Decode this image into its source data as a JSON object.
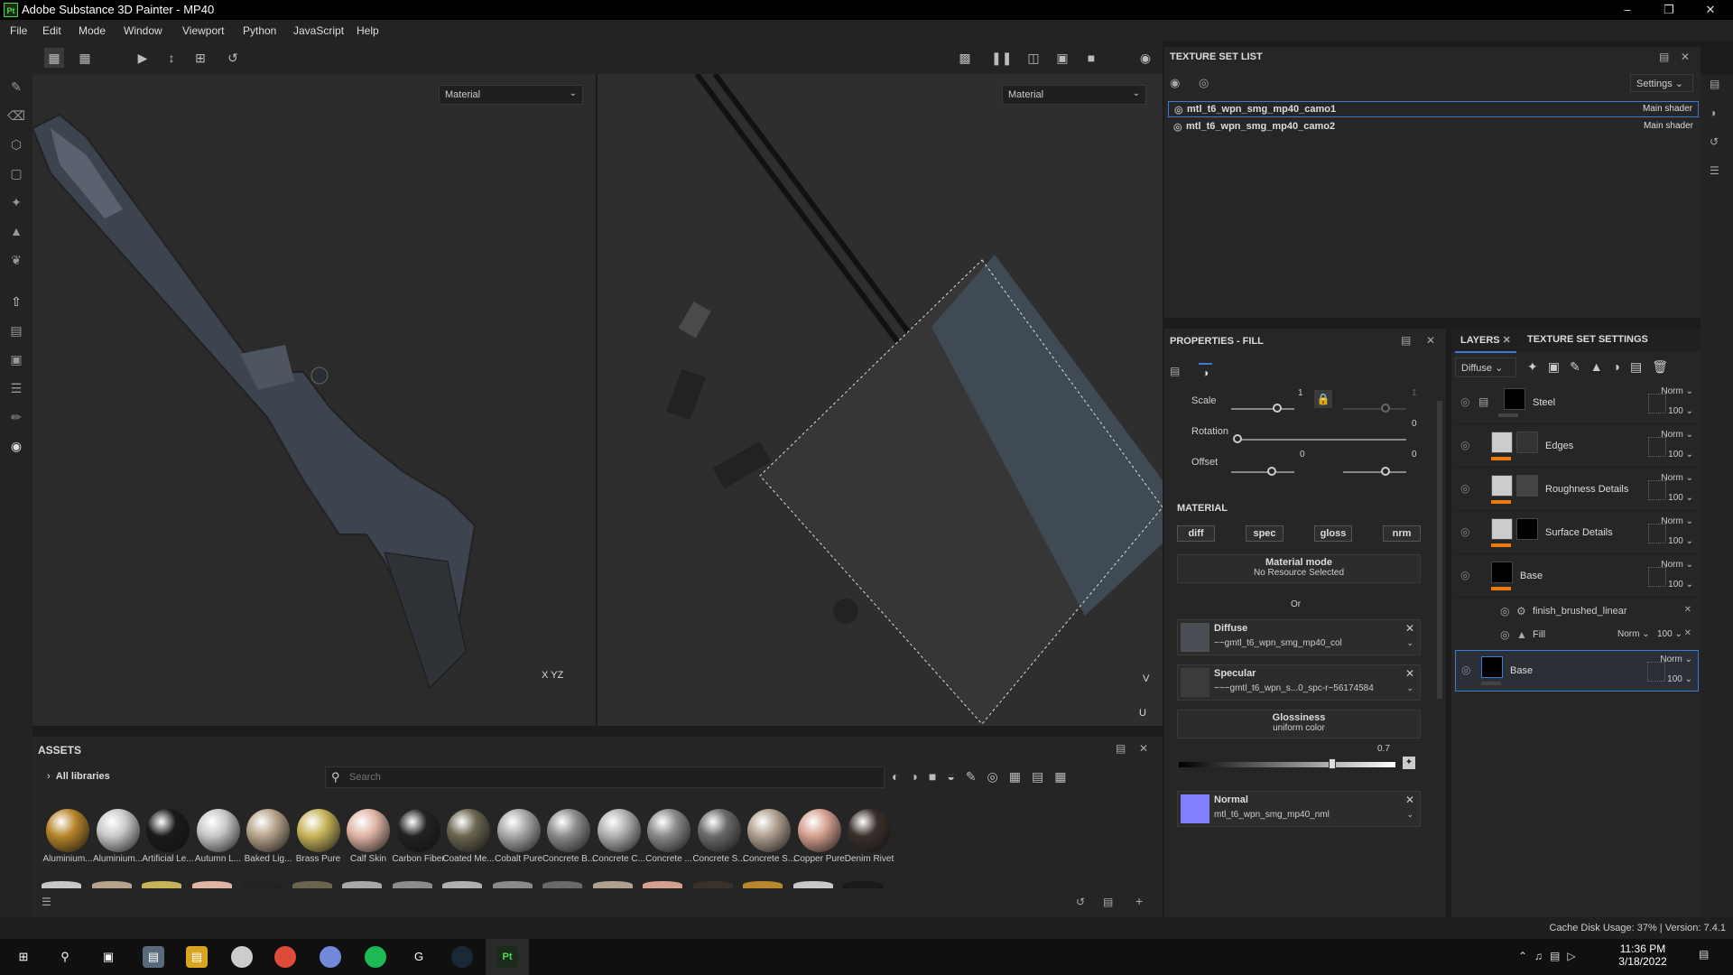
{
  "app": {
    "title": "Adobe Substance 3D Painter - MP40",
    "icon_text": "Pt"
  },
  "menu": [
    "File",
    "Edit",
    "Mode",
    "Window",
    "Viewport",
    "Python",
    "JavaScript",
    "Help"
  ],
  "viewport": {
    "left_mode": "Material",
    "right_mode": "Material",
    "axis_x": "X",
    "axis_y": "Y",
    "axis_z": "Z",
    "uv_v": "V",
    "uv_u": "U"
  },
  "texture_set_list": {
    "title": "TEXTURE SET LIST",
    "settings": "Settings",
    "items": [
      {
        "name": "mtl_t6_wpn_smg_mp40_camo1",
        "shader": "Main shader"
      },
      {
        "name": "mtl_t6_wpn_smg_mp40_camo2",
        "shader": "Main shader"
      }
    ]
  },
  "properties": {
    "title": "PROPERTIES - FILL",
    "scale_label": "Scale",
    "scale_val": "1",
    "scale_val2": "1",
    "rotation_label": "Rotation",
    "rotation_val": "0",
    "offset_label": "Offset",
    "offset_val1": "0",
    "offset_val2": "0",
    "material_heading": "MATERIAL",
    "channels": [
      "diff",
      "spec",
      "gloss",
      "nrm"
    ],
    "material_mode": "Material mode",
    "no_resource": "No Resource Selected",
    "or": "Or",
    "diffuse": {
      "title": "Diffuse",
      "value": "~~gmtl_t6_wpn_smg_mp40_col"
    },
    "specular": {
      "title": "Specular",
      "value": "~~~gmtl_t6_wpn_s...0_spc-r~56174584"
    },
    "glossiness": {
      "title": "Glossiness",
      "value": "uniform color",
      "amount": "0.7"
    },
    "normal": {
      "title": "Normal",
      "value": "mtl_t6_wpn_smg_mp40_nml",
      "color": "#8080ff"
    }
  },
  "layers": {
    "tab1": "LAYERS",
    "tab2": "TEXTURE SET SETTINGS",
    "channel": "Diffuse",
    "items": [
      {
        "name": "Steel",
        "blend": "Norm",
        "opacity": "100"
      },
      {
        "name": "Edges",
        "blend": "Norm",
        "opacity": "100"
      },
      {
        "name": "Roughness Details",
        "blend": "Norm",
        "opacity": "100"
      },
      {
        "name": "Surface Details",
        "blend": "Norm",
        "opacity": "100"
      },
      {
        "name": "Base",
        "blend": "Norm",
        "opacity": "100"
      },
      {
        "name": "Base",
        "blend": "Norm",
        "opacity": "100"
      }
    ],
    "sub1": "finish_brushed_linear",
    "sub2": "Fill",
    "sub2_blend": "Norm",
    "sub2_opacity": "100"
  },
  "assets": {
    "title": "ASSETS",
    "library": "All libraries",
    "search_placeholder": "Search",
    "items": [
      "Aluminium...",
      "Aluminium...",
      "Artificial Le...",
      "Autumn L...",
      "Baked Lig...",
      "Brass Pure",
      "Calf Skin",
      "Carbon Fiber",
      "Coated Me...",
      "Cobalt Pure",
      "Concrete B...",
      "Concrete C...",
      "Concrete ...",
      "Concrete S...",
      "Concrete S...",
      "Copper Pure",
      "Denim Rivet"
    ]
  },
  "status": {
    "text": "Cache Disk Usage:  37% | Version: 7.4.1"
  },
  "taskbar": {
    "time": "11:36 PM",
    "date": "3/18/2022"
  }
}
